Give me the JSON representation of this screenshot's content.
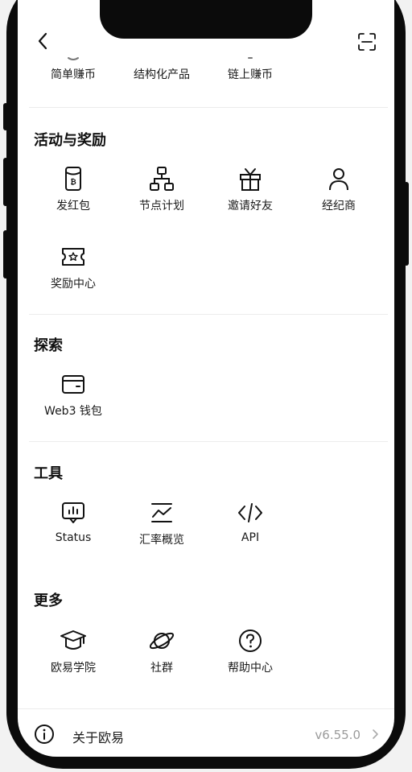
{
  "top_row": [
    {
      "label": "简单赚币"
    },
    {
      "label": "结构化产品"
    },
    {
      "label": "链上赚币"
    }
  ],
  "sections": {
    "activities": {
      "title": "活动与奖励",
      "items": [
        {
          "label": "发红包",
          "icon": "red-packet-icon"
        },
        {
          "label": "节点计划",
          "icon": "node-tree-icon"
        },
        {
          "label": "邀请好友",
          "icon": "gift-icon"
        },
        {
          "label": "经纪商",
          "icon": "person-icon"
        },
        {
          "label": "奖励中心",
          "icon": "ticket-star-icon"
        }
      ]
    },
    "explore": {
      "title": "探索",
      "items": [
        {
          "label": "Web3 钱包",
          "icon": "wallet-icon"
        }
      ]
    },
    "tools": {
      "title": "工具",
      "items": [
        {
          "label": "Status",
          "icon": "status-monitor-icon"
        },
        {
          "label": "汇率概览",
          "icon": "rate-chart-icon"
        },
        {
          "label": "API",
          "icon": "code-icon"
        }
      ]
    },
    "more": {
      "title": "更多",
      "items": [
        {
          "label": "欧易学院",
          "icon": "graduation-cap-icon"
        },
        {
          "label": "社群",
          "icon": "planet-icon"
        },
        {
          "label": "帮助中心",
          "icon": "question-icon"
        }
      ]
    }
  },
  "footer": {
    "label": "关于欧易",
    "version": "v6.55.0"
  }
}
